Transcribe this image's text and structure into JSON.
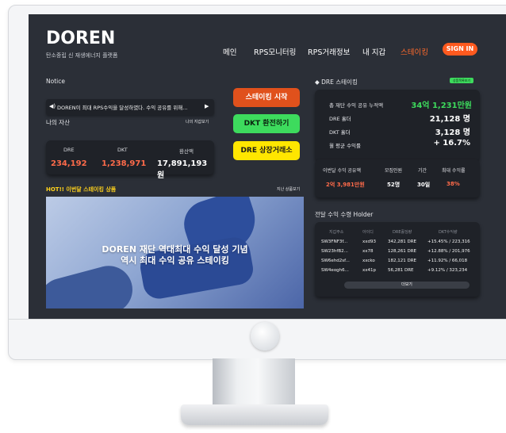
{
  "header": {
    "logo": "DOREN",
    "tagline": "탄소중립 신 재생에너지 플랫폼",
    "nav": [
      "메인",
      "RPS모니터링",
      "RPS거래정보",
      "내 지갑",
      "스테이킹"
    ],
    "signin": "SIGN IN"
  },
  "notice": {
    "label": "Notice",
    "text": "DOREN이 최대 RPS수익을 달성하였다. 수익 공유를 위해..."
  },
  "assets": {
    "label": "나의 자산",
    "link": "나의 지갑보기",
    "headers": [
      "DRE",
      "DKT",
      "환산액"
    ],
    "values": [
      "234,192",
      "1,238,971",
      "17,891,193 원"
    ]
  },
  "buttons": {
    "staking": "스테이킹 시작",
    "dkt_exchange": "DKT 환전하기",
    "dre_exchange": "DRE 상장거래소"
  },
  "hot": {
    "label": "HOT!! 이번달 스테이킹 상품",
    "link": "지난 상품보기",
    "banner_line1": "DOREN 재단 역대최대 수익 달성 기념",
    "banner_line2": "역시 최대 수익 공유 스테이킹"
  },
  "dre_staking": {
    "title": "◆ DRE 스테이킹",
    "badge": "상품목록보기",
    "rows": [
      {
        "label": "총 재단 수익 공유 누적액",
        "value": "34억 1,231만원"
      },
      {
        "label": "DRE 홀더",
        "value": "21,128 명"
      },
      {
        "label": "DKT 홀더",
        "value": "3,128 명"
      },
      {
        "label": "월 평균 수익률",
        "value": "+ 16.7%"
      }
    ],
    "sub_headers": [
      "이번달 수익 공유액",
      "모집인원",
      "기간",
      "최대 수익률"
    ],
    "sub_values": [
      "2억 3,981만원",
      "52명",
      "30일",
      "38%"
    ]
  },
  "holders": {
    "title": "전달 수익 수령 Holder",
    "headers": [
      "지갑주소",
      "아이디",
      "DRE홀딩량",
      "DKT수익량"
    ],
    "rows": [
      [
        "SW3FNF3f...",
        "xxd93",
        "342,281 DRE",
        "+15.45% / 223,316"
      ],
      [
        "SW23hfB2...",
        "xx78",
        "128,261 DRE",
        "+12.88% / 201,976"
      ],
      [
        "SW6ehd2sf...",
        "xxcko",
        "182,121 DRE",
        "+11.92% / 66,018"
      ],
      [
        "SW4eogh6...",
        "xx41p",
        "56,281 DRE",
        "+9.12% / 323,234"
      ]
    ],
    "more": "더보기"
  },
  "colors": {
    "accent_orange": "#ff5a1f",
    "green": "#3ddb5d",
    "yellow": "#ffe600",
    "negative_red": "#ff6b4a",
    "screen_bg": "#2b2f37"
  }
}
